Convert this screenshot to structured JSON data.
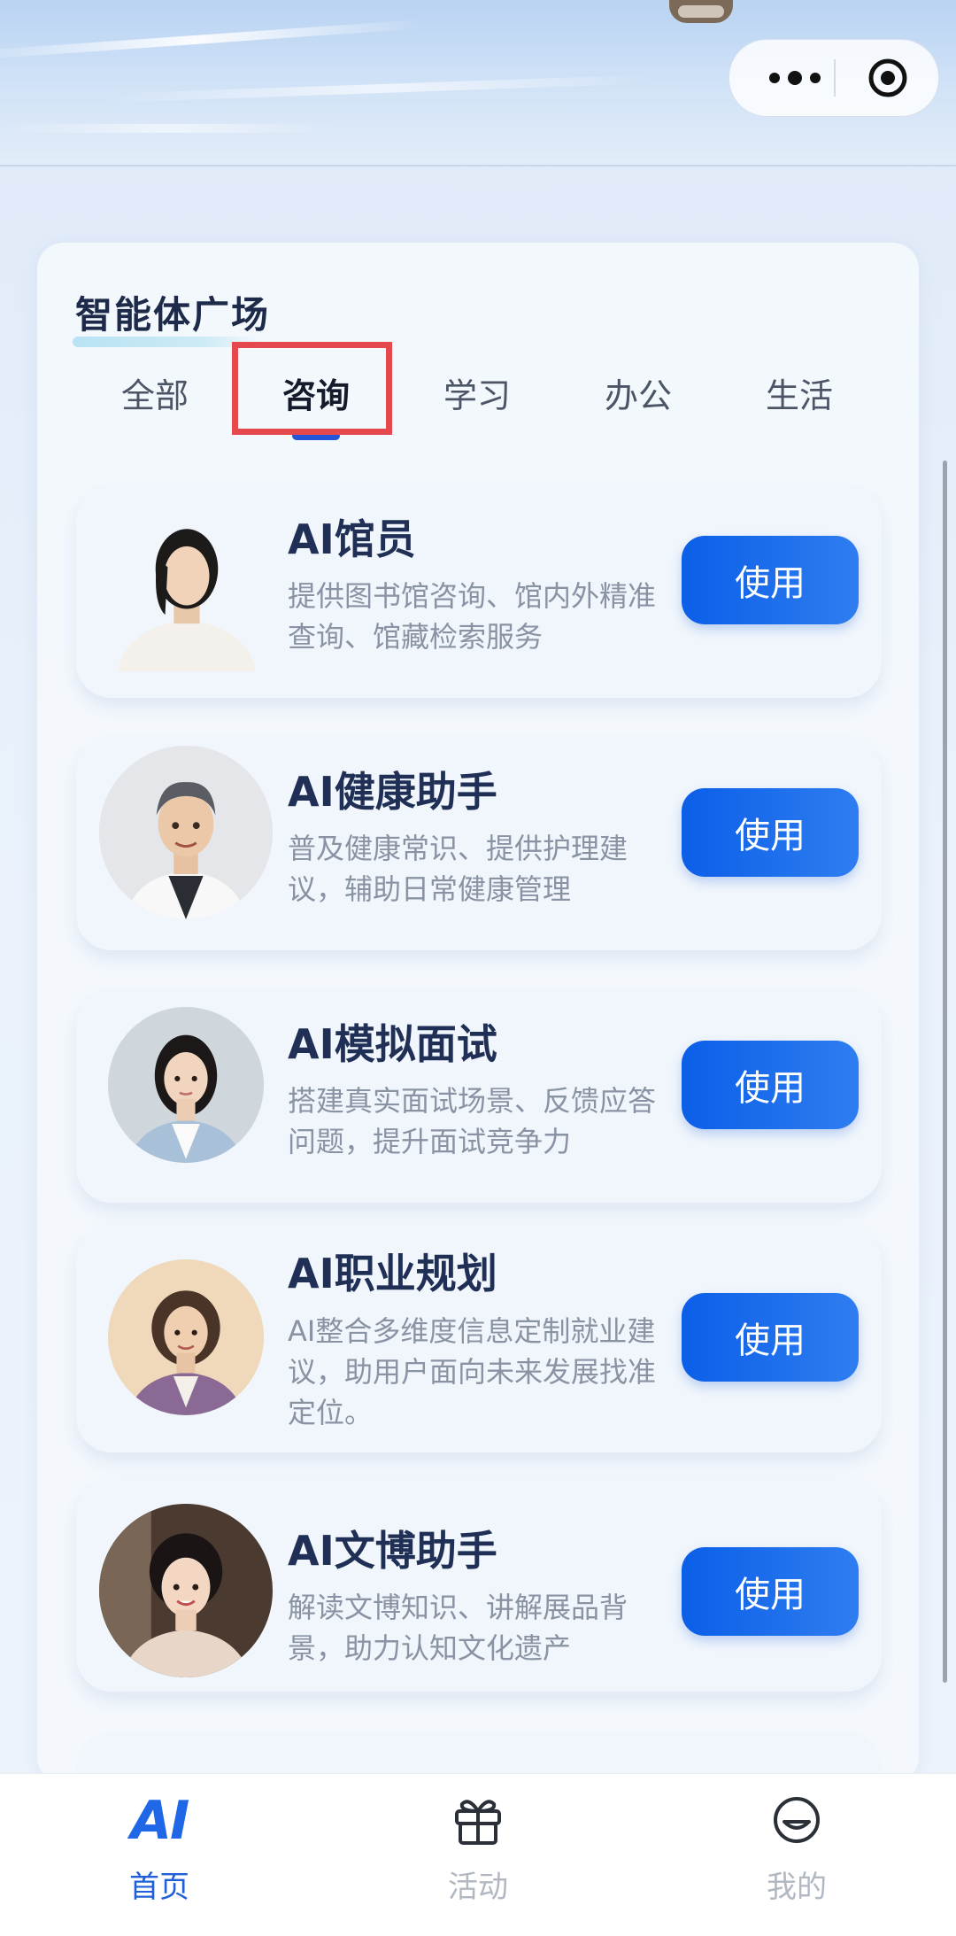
{
  "header": {
    "capsule": {
      "more_icon": "more-dots-icon",
      "close_icon": "record-target-icon"
    }
  },
  "section": {
    "title": "智能体广场",
    "tabs": [
      {
        "label": "全部",
        "active": false
      },
      {
        "label": "咨询",
        "active": true
      },
      {
        "label": "学习",
        "active": false
      },
      {
        "label": "办公",
        "active": false
      },
      {
        "label": "生活",
        "active": false
      }
    ]
  },
  "agents": [
    {
      "name": "AI馆员",
      "description": "提供图书馆咨询、馆内外精准查询、馆藏检索服务",
      "button": "使用",
      "avatar": "librarian-avatar"
    },
    {
      "name": "AI健康助手",
      "description": "普及健康常识、提供护理建议，辅助日常健康管理",
      "button": "使用",
      "avatar": "doctor-avatar"
    },
    {
      "name": "AI模拟面试",
      "description": "搭建真实面试场景、反馈应答问题，提升面试竞争力",
      "button": "使用",
      "avatar": "interviewer-avatar"
    },
    {
      "name": "AI职业规划",
      "description": "AI整合多维度信息定制就业建议，助用户面向未来发展找准定位。",
      "button": "使用",
      "avatar": "career-advisor-avatar"
    },
    {
      "name": "AI文博助手",
      "description": "解读文博知识、讲解展品背景，助力认知文化遗产",
      "button": "使用",
      "avatar": "museum-guide-avatar"
    }
  ],
  "bottom_nav": {
    "items": [
      {
        "label": "首页",
        "icon": "ai-logo-icon",
        "active": true
      },
      {
        "label": "活动",
        "icon": "gift-icon",
        "active": false
      },
      {
        "label": "我的",
        "icon": "smile-face-icon",
        "active": false
      }
    ]
  },
  "colors": {
    "accent": "#1f5fd8",
    "button": "#0b5fe8",
    "highlight": "#e5484d"
  }
}
